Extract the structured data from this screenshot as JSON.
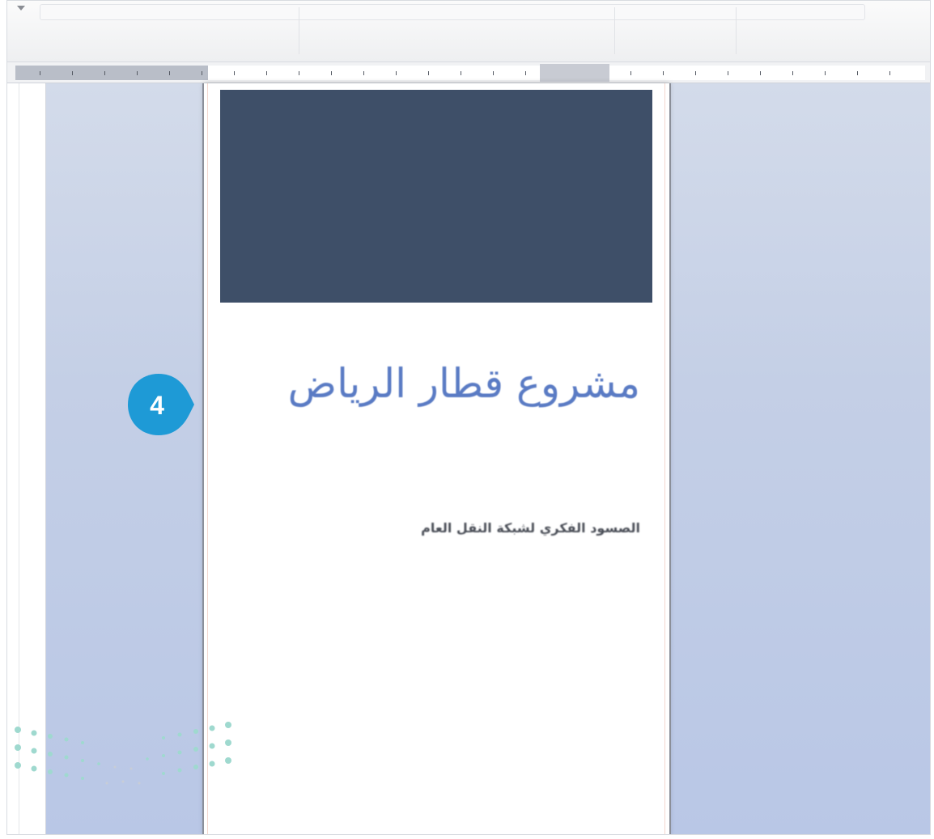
{
  "document": {
    "title": "مشروع قطار الرياض",
    "subtitle": "الصسود الفكري لشبكة النقل العام"
  },
  "step_marker": {
    "number": "4",
    "color": "#1e9ad6"
  },
  "colors": {
    "cover_block": "#3e4f68",
    "title_text": "#5a7bc4",
    "workspace_bg": "#c4cfe6",
    "dots": "#9fd9cf"
  }
}
